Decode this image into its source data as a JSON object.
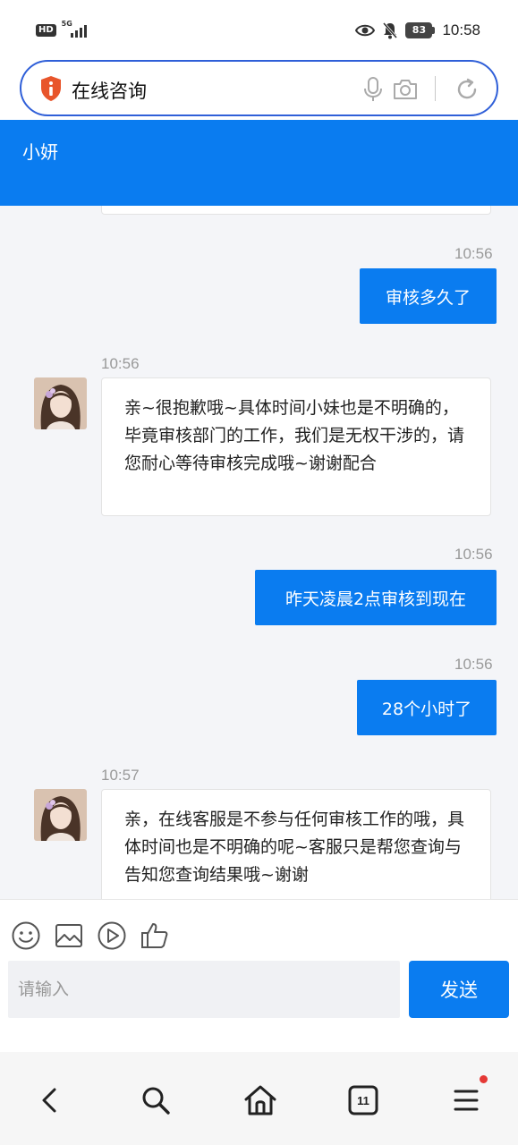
{
  "status_bar": {
    "hd": "HD",
    "network": "5G",
    "battery": "83",
    "time": "10:58"
  },
  "browser": {
    "search_text": "在线咨询",
    "icons": [
      "shield-info-icon",
      "mic-icon",
      "camera-icon",
      "refresh-icon"
    ]
  },
  "header": {
    "agent_name": "小妍",
    "color": "#0a7cf0"
  },
  "messages": [
    {
      "side": "out",
      "time": "10:56",
      "text": "审核多久了"
    },
    {
      "side": "in",
      "time": "10:56",
      "text": "亲~很抱歉哦~具体时间小妹也是不明确的，毕竟审核部门的工作，我们是无权干涉的，请您耐心等待审核完成哦~谢谢配合"
    },
    {
      "side": "out",
      "time": "10:56",
      "text": "昨天凌晨2点审核到现在"
    },
    {
      "side": "out",
      "time": "10:56",
      "text": "28个小时了"
    },
    {
      "side": "in",
      "time": "10:57",
      "text": "亲，在线客服是不参与任何审核工作的哦，具体时间也是不明确的呢~客服只是帮您查询与告知您查询结果哦~谢谢"
    }
  ],
  "composer": {
    "tools": [
      "emoji-icon",
      "image-icon",
      "video-icon",
      "thumbs-up-icon"
    ],
    "placeholder": "请输入",
    "send_label": "发送"
  },
  "bottom_nav": {
    "items": [
      "back-icon",
      "search-icon",
      "home-icon",
      "tabs-icon",
      "menu-icon"
    ],
    "tabs_count": "11"
  }
}
